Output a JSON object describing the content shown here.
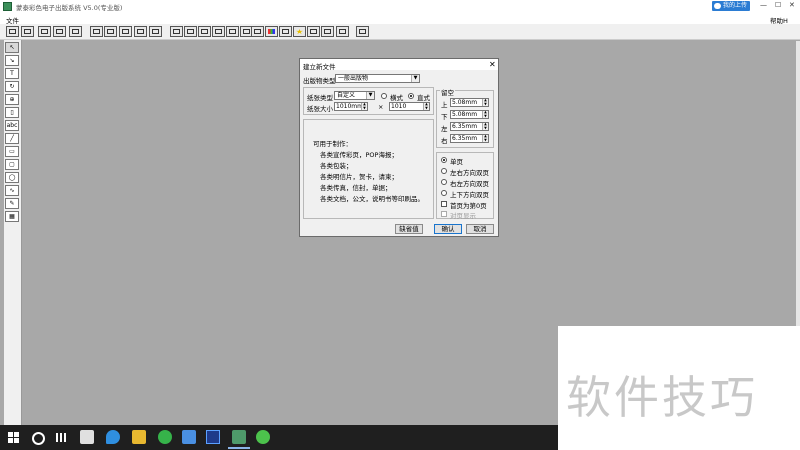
{
  "window": {
    "title": "蒙泰彩色电子出版系统 V5.0(专业版)",
    "cloud_button": "我的上传",
    "minimize": "—",
    "maximize": "☐",
    "close": "✕"
  },
  "menu": {
    "file": "文件",
    "help": "帮助H"
  },
  "dialog": {
    "title": "建立新文件",
    "close": "✕",
    "pub_type_label": "出版物类型",
    "pub_type_value": "一般出版物",
    "paper_type_label": "纸张类型",
    "paper_type_value": "自定义",
    "orientation": {
      "landscape": "横式",
      "portrait": "直式",
      "selected": "portrait"
    },
    "paper_size_label": "纸张大小",
    "width": "1010mm",
    "times": "×",
    "height": "1010",
    "margins": {
      "title": "留空",
      "top_label": "上",
      "top": "5.08mm",
      "bottom_label": "下",
      "bottom": "5.08mm",
      "left_label": "左",
      "left": "6.35mm",
      "right_label": "右",
      "right": "6.35mm"
    },
    "info": {
      "heading": "可用于制作：",
      "lines": [
        "各类宣传彩页，POP海报；",
        "各类包装；",
        "各类明信片，贺卡，请柬；",
        "各类传真，信封，单据；",
        "各类文档，公文，说明书等印刷品。"
      ]
    },
    "page_options": {
      "single": "单页",
      "lr_double": "左右方向双页",
      "rl_double": "右左方向双页",
      "ud_double": "上下方向双页",
      "first_zero": "首页为第0页",
      "show_facing": "对页显示",
      "selected": "single"
    },
    "buttons": {
      "default": "缺省值",
      "ok": "确认",
      "cancel": "取消"
    }
  },
  "watermark": {
    "text": "软件技巧"
  },
  "colors": {
    "canvas": "#a8a8a8",
    "taskbar": "#1f1f1f",
    "cloud": "#2b7cd3"
  },
  "toolbar_icons": [
    "new-file-icon",
    "save-icon",
    "open-icon",
    "image-icon",
    "print-icon",
    "undo-icon",
    "redo-icon",
    "cut-icon",
    "copy-icon",
    "paste-icon",
    "align-icon",
    "text-frame-icon",
    "column-icon",
    "flow-icon",
    "layer-icon",
    "page-icon",
    "zoom-icon",
    "color-icon",
    "fill-icon",
    "star-icon",
    "clipart-icon",
    "chart-icon",
    "effect-icon",
    "settings-icon"
  ],
  "tools": [
    "pointer-tool-icon",
    "direct-select-tool-icon",
    "text-tool-icon",
    "rotate-tool-icon",
    "zoom-tool-icon",
    "rectangle-frame-tool-icon",
    "text-abc-tool-icon",
    "line-tool-icon",
    "rect-tool-icon",
    "rounded-rect-tool-icon",
    "ellipse-tool-icon",
    "bezier-tool-icon",
    "pen-tool-icon",
    "table-tool-icon"
  ],
  "taskbar_icons": [
    "windows-start-icon",
    "search-icon",
    "task-view-icon",
    "fan-app-icon",
    "edge-icon",
    "file-explorer-icon",
    "browser-icon",
    "baidu-netdisk-icon",
    "photoshop-icon",
    "montai-app-icon",
    "wechat-icon"
  ]
}
